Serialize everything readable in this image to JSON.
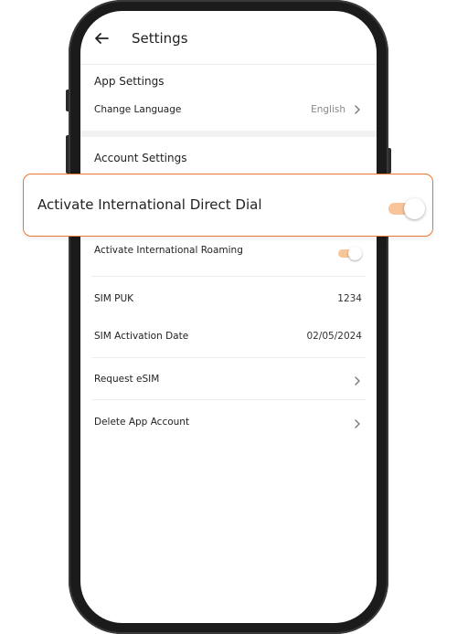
{
  "header": {
    "title": "Settings"
  },
  "sections": {
    "app_settings": "App Settings",
    "account_settings": "Account Settings"
  },
  "rows": {
    "change_language": {
      "label": "Change Language",
      "value": "English"
    },
    "intl_direct_dial": {
      "label": "Activate International Direct Dial",
      "enabled": true
    },
    "intl_roaming": {
      "label": "Activate International Roaming",
      "enabled": true
    },
    "sim_puk": {
      "label": "SIM PUK",
      "value": "1234"
    },
    "sim_activation_date": {
      "label": "SIM Activation Date",
      "value": "02/05/2024"
    },
    "request_esim": {
      "label": "Request eSIM"
    },
    "delete_account": {
      "label": "Delete App Account"
    }
  },
  "colors": {
    "accent": "#e8782c",
    "toggle_track": "#f8c49a",
    "section_band": "#f2f2f2"
  },
  "icons": {
    "back": "arrow-left-icon",
    "chevron": "chevron-right-icon"
  }
}
